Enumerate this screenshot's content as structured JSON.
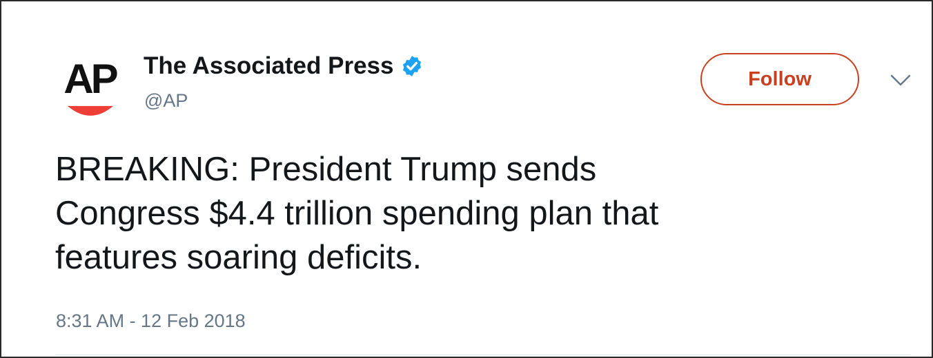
{
  "account": {
    "display_name": "The Associated Press",
    "handle": "@AP",
    "avatar_text": "AP",
    "verified": true
  },
  "actions": {
    "follow_label": "Follow",
    "more_icon": "chevron-down-icon"
  },
  "tweet": {
    "lines": [
      "BREAKING: President Trump sends",
      "Congress $4.4 trillion spending plan that",
      "features soaring deficits."
    ],
    "timestamp": "8:31 AM - 12 Feb 2018"
  },
  "colors": {
    "accent": "#c8401f",
    "verified": "#1da1f2",
    "text": "#14171a",
    "muted": "#657786",
    "logo_arc": "#ef3e36"
  }
}
